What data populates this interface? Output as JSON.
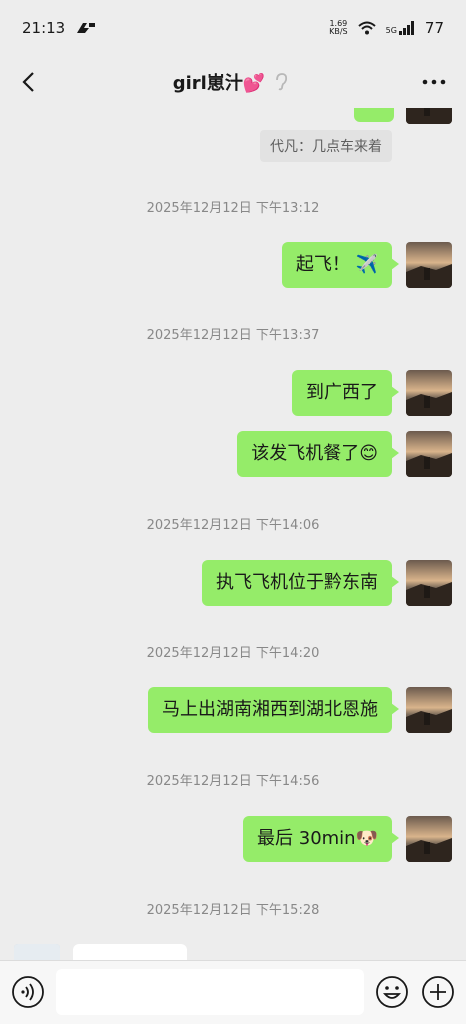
{
  "status": {
    "time": "21:13",
    "net_speed_value": "1.69",
    "net_speed_unit": "KB/S",
    "network": "5G",
    "battery": "77"
  },
  "header": {
    "title": "girl崽汁💕"
  },
  "quote": {
    "text": "代凡：几点车来着"
  },
  "messages": [
    {
      "timestamp": "2025年12月12日 下午13:12",
      "text": "起飞！ ✈️"
    },
    {
      "timestamp": "2025年12月12日 下午13:37",
      "text": "到广西了"
    },
    {
      "text": "该发飞机餐了😊"
    },
    {
      "timestamp": "2025年12月12日 下午14:06",
      "text": "执飞飞机位于黔东南"
    },
    {
      "timestamp": "2025年12月12日 下午14:20",
      "text": "马上出湖南湘西到湖北恩施"
    },
    {
      "timestamp": "2025年12月12日 下午14:56",
      "text": "最后 30min🐶"
    },
    {
      "timestamp": "2025年12月12日 下午15:28"
    }
  ],
  "colors": {
    "bubble_self": "#95ec69",
    "background": "#ededed"
  }
}
